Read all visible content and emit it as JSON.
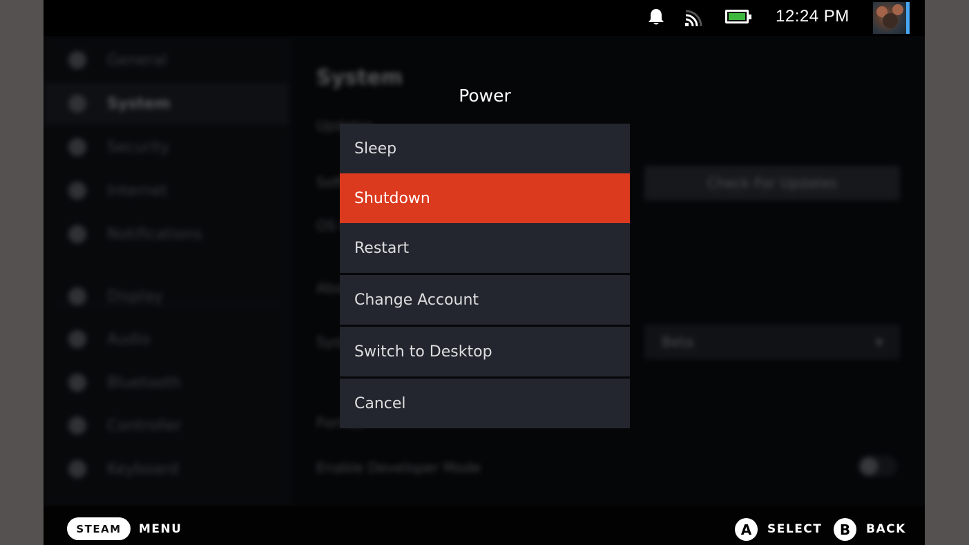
{
  "status_bar": {
    "icons": [
      "bell-icon",
      "wifi-signal-icon",
      "battery-icon"
    ],
    "battery_level": 1.0,
    "battery_color": "#3db73d",
    "time": "12:24 PM",
    "avatar_accent": "#49a7f2"
  },
  "background": {
    "sidebar": {
      "items": [
        {
          "label": "General",
          "icon": "info-icon"
        },
        {
          "label": "System",
          "icon": "system-icon",
          "active": true
        },
        {
          "label": "Security",
          "icon": "lock-icon"
        },
        {
          "label": "Internet",
          "icon": "wifi-icon"
        },
        {
          "label": "Notifications",
          "icon": "bell-icon"
        },
        {
          "label": "Display",
          "icon": "display-icon"
        },
        {
          "label": "Audio",
          "icon": "audio-icon"
        },
        {
          "label": "Bluetooth",
          "icon": "bluetooth-icon"
        },
        {
          "label": "Controller",
          "icon": "controller-icon"
        },
        {
          "label": "Keyboard",
          "icon": "keyboard-icon"
        }
      ]
    },
    "main": {
      "title": "System",
      "rows": [
        "Updates",
        "Software Updates",
        "OS Update Channel",
        "About",
        "System Update Channel",
        "Format",
        "Enable Developer Mode"
      ],
      "check_updates_button": "Check For Updates",
      "dropdown_value": "Beta"
    }
  },
  "dialog": {
    "title": "Power",
    "items": [
      {
        "label": "Sleep",
        "selected": false
      },
      {
        "label": "Shutdown",
        "selected": true
      },
      {
        "label": "Restart",
        "selected": false
      },
      {
        "label": "Change Account",
        "selected": false
      },
      {
        "label": "Switch to Desktop",
        "selected": false
      },
      {
        "label": "Cancel",
        "selected": false
      }
    ],
    "accent_color": "#dc3a1e"
  },
  "bottom_bar": {
    "steam_label": "STEAM",
    "menu_label": "MENU",
    "a_button": "A",
    "select_label": "SELECT",
    "b_button": "B",
    "back_label": "BACK"
  }
}
